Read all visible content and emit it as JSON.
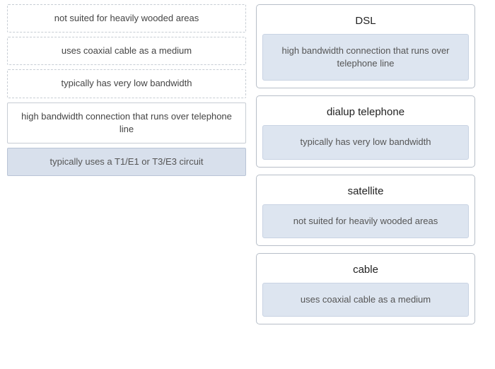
{
  "source": {
    "items": [
      {
        "label": "not suited for heavily wooded areas",
        "state": "dashed"
      },
      {
        "label": "uses coaxial cable as a medium",
        "state": "dashed"
      },
      {
        "label": "typically has very low bandwidth",
        "state": "dashed"
      },
      {
        "label": "high bandwidth connection that runs over telephone line",
        "state": "solid"
      },
      {
        "label": "typically uses a T1/E1 or T3/E3 circuit",
        "state": "dragging"
      }
    ]
  },
  "targets": [
    {
      "title": "DSL",
      "dropped": "high bandwidth connection that runs over telephone line"
    },
    {
      "title": "dialup telephone",
      "dropped": "typically has very low bandwidth"
    },
    {
      "title": "satellite",
      "dropped": "not suited for heavily wooded areas"
    },
    {
      "title": "cable",
      "dropped": "uses coaxial cable as a medium"
    }
  ]
}
